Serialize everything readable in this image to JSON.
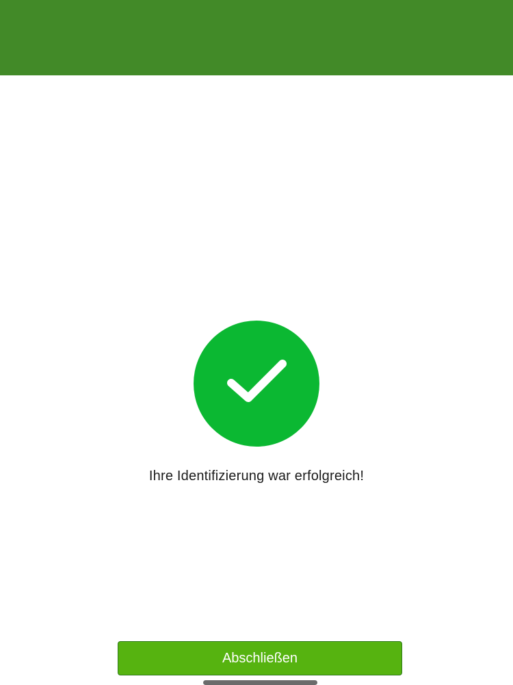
{
  "header": {
    "color": "#428a28"
  },
  "result": {
    "icon": "checkmark-icon",
    "icon_color": "#0bb832",
    "message": "Ihre Identifizierung war erfolgreich!"
  },
  "footer": {
    "finish_label": "Abschließen",
    "button_color": "#56b310"
  }
}
